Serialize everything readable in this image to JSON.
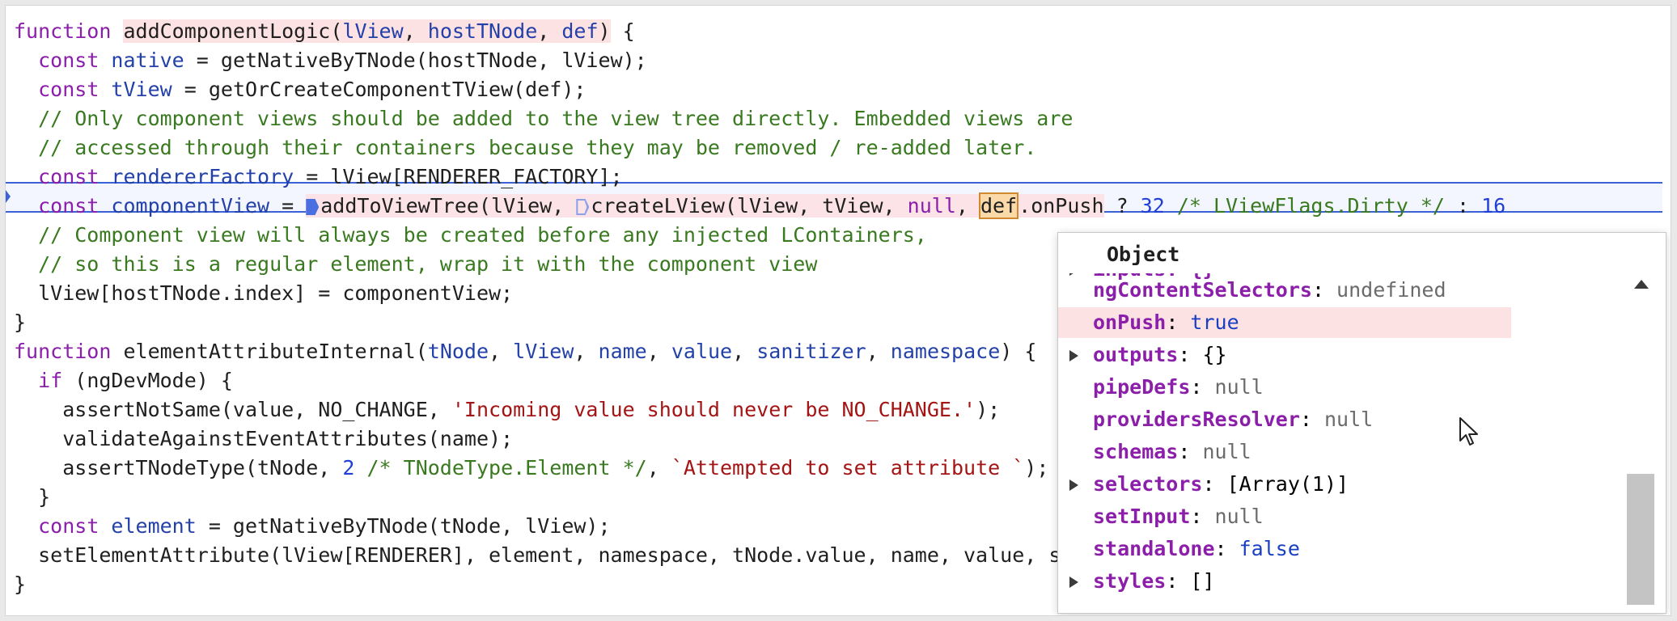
{
  "code_lines": [
    {
      "segments": [
        {
          "t": "function ",
          "c": "kw"
        },
        {
          "t": "addComponentLogic(",
          "c": "fn hl-param"
        },
        {
          "t": "lView",
          "c": "var hl-param"
        },
        {
          "t": ", ",
          "c": "hl-param"
        },
        {
          "t": "hostTNode",
          "c": "var hl-param"
        },
        {
          "t": ", ",
          "c": "hl-param"
        },
        {
          "t": "def",
          "c": "var hl-param"
        },
        {
          "t": ")",
          "c": "hl-param"
        },
        {
          "t": " {",
          "c": ""
        }
      ]
    },
    {
      "segments": [
        {
          "t": "  ",
          "c": ""
        },
        {
          "t": "const ",
          "c": "decl"
        },
        {
          "t": "native",
          "c": "var"
        },
        {
          "t": " = getNativeByTNode(hostTNode, lView);",
          "c": ""
        }
      ]
    },
    {
      "segments": [
        {
          "t": "  ",
          "c": ""
        },
        {
          "t": "const ",
          "c": "decl"
        },
        {
          "t": "tView",
          "c": "var"
        },
        {
          "t": " = getOrCreateComponentTView(def);",
          "c": ""
        }
      ]
    },
    {
      "segments": [
        {
          "t": "  // Only component views should be added to the view tree directly. Embedded views are",
          "c": "cm"
        }
      ]
    },
    {
      "segments": [
        {
          "t": "  // accessed through their containers because they may be removed / re-added later.",
          "c": "cm"
        }
      ]
    },
    {
      "segments": [
        {
          "t": "  ",
          "c": ""
        },
        {
          "t": "const ",
          "c": "decl"
        },
        {
          "t": "rendererFactory",
          "c": "var"
        },
        {
          "t": " = lView[RENDERER_FACTORY];",
          "c": ""
        }
      ]
    },
    {
      "segments": []
    },
    {
      "segments": [
        {
          "t": "  // Component view will always be created before any injected LContainers,",
          "c": "cm"
        }
      ]
    },
    {
      "segments": [
        {
          "t": "  // so this is a regular element, wrap it with the component view",
          "c": "cm"
        }
      ]
    },
    {
      "segments": [
        {
          "t": "  lView[hostTNode.index] = componentView;",
          "c": ""
        }
      ]
    },
    {
      "segments": [
        {
          "t": "}",
          "c": ""
        }
      ]
    },
    {
      "segments": [
        {
          "t": "function ",
          "c": "kw"
        },
        {
          "t": "elementAttributeInternal(",
          "c": "fn"
        },
        {
          "t": "tNode",
          "c": "var"
        },
        {
          "t": ", ",
          "c": ""
        },
        {
          "t": "lView",
          "c": "var"
        },
        {
          "t": ", ",
          "c": ""
        },
        {
          "t": "name",
          "c": "var"
        },
        {
          "t": ", ",
          "c": ""
        },
        {
          "t": "value",
          "c": "var"
        },
        {
          "t": ", ",
          "c": ""
        },
        {
          "t": "sanitizer",
          "c": "var"
        },
        {
          "t": ", ",
          "c": ""
        },
        {
          "t": "namespace",
          "c": "var"
        },
        {
          "t": ") {",
          "c": ""
        }
      ]
    },
    {
      "segments": [
        {
          "t": "  ",
          "c": ""
        },
        {
          "t": "if",
          "c": "kw"
        },
        {
          "t": " (ngDevMode) {",
          "c": ""
        }
      ]
    },
    {
      "segments": [
        {
          "t": "    assertNotSame(value, NO_CHANGE, ",
          "c": ""
        },
        {
          "t": "'Incoming value should never be NO_CHANGE.'",
          "c": "str"
        },
        {
          "t": ");",
          "c": ""
        }
      ]
    },
    {
      "segments": [
        {
          "t": "    validateAgainstEventAttributes(name);",
          "c": ""
        }
      ]
    },
    {
      "segments": [
        {
          "t": "    assertTNodeType(tNode, ",
          "c": ""
        },
        {
          "t": "2",
          "c": "num"
        },
        {
          "t": " /* TNodeType.Element */",
          "c": "cm"
        },
        {
          "t": ", ",
          "c": ""
        },
        {
          "t": "`Attempted to set attribute `",
          "c": "str"
        },
        {
          "t": ");",
          "c": ""
        }
      ]
    },
    {
      "segments": [
        {
          "t": "  }",
          "c": ""
        }
      ]
    },
    {
      "segments": [
        {
          "t": "  ",
          "c": ""
        },
        {
          "t": "const ",
          "c": "decl"
        },
        {
          "t": "element",
          "c": "var"
        },
        {
          "t": " = getNativeByTNode(tNode, lView);",
          "c": ""
        }
      ]
    },
    {
      "segments": [
        {
          "t": "  setElementAttribute(lView[RENDERER], element, namespace, tNode.value, name, value, sanitizer);",
          "c": ""
        }
      ]
    },
    {
      "segments": [
        {
          "t": "}",
          "c": ""
        }
      ]
    }
  ],
  "exec_line": {
    "indent": "  ",
    "kw": "const ",
    "var": "componentView",
    "eq": " = ",
    "call1": "addToViewTree(lView, ",
    "call2": "createLView(lView, tView, ",
    "null_kw": "null",
    "comma": ", ",
    "def_token": "def",
    "after_def": ".onPush",
    "rest1": " ? ",
    "n32": "32",
    "cm_dirty": " /* LViewFlags.Dirty */",
    "rest2": " : ",
    "n16": "16"
  },
  "popover": {
    "title": "Object",
    "partial_top": "inputs: {}",
    "props": [
      {
        "key": "ngContentSelectors",
        "value": "undefined",
        "vtype": "null",
        "expandable": false,
        "highlight": false
      },
      {
        "key": "onPush",
        "value": "true",
        "vtype": "kw",
        "expandable": false,
        "highlight": true
      },
      {
        "key": "outputs",
        "value": "{}",
        "vtype": "plain",
        "expandable": true,
        "highlight": false
      },
      {
        "key": "pipeDefs",
        "value": "null",
        "vtype": "null",
        "expandable": false,
        "highlight": false
      },
      {
        "key": "providersResolver",
        "value": "null",
        "vtype": "null",
        "expandable": false,
        "highlight": false
      },
      {
        "key": "schemas",
        "value": "null",
        "vtype": "null",
        "expandable": false,
        "highlight": false
      },
      {
        "key": "selectors",
        "value": "[Array(1)]",
        "vtype": "plain",
        "expandable": true,
        "highlight": false
      },
      {
        "key": "setInput",
        "value": "null",
        "vtype": "null",
        "expandable": false,
        "highlight": false
      },
      {
        "key": "standalone",
        "value": "false",
        "vtype": "kw",
        "expandable": false,
        "highlight": false
      },
      {
        "key": "styles",
        "value": "[]",
        "vtype": "plain",
        "expandable": true,
        "highlight": false
      }
    ]
  },
  "colors": {
    "keyword": "#8b1fa9",
    "variable": "#2341a8",
    "comment": "#397a20",
    "string": "#a31515",
    "number": "#1f3fd6",
    "exec_highlight": "#3b62d6",
    "param_highlight": "#fde2e4"
  }
}
